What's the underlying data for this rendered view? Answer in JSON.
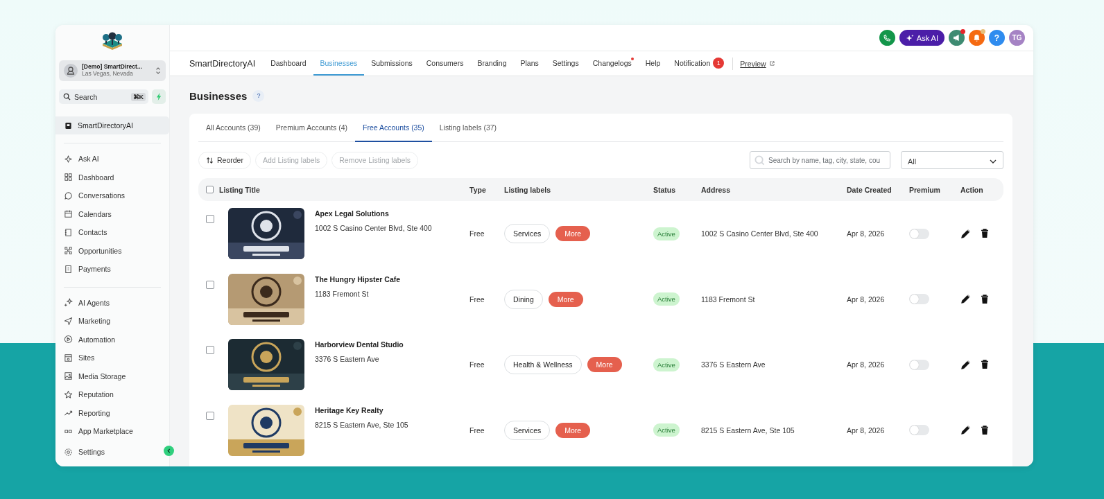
{
  "sidebar": {
    "account": {
      "name": "[Demo] SmartDirect...",
      "location": "Las Vegas, Nevada"
    },
    "search": {
      "placeholder": "Search",
      "shortcut": "⌘K"
    },
    "workspace": {
      "label": "SmartDirectoryAI",
      "selected": true
    },
    "groups": [
      {
        "items": [
          {
            "label": "Ask AI",
            "selected": false
          },
          {
            "label": "Dashboard",
            "selected": false
          },
          {
            "label": "Conversations",
            "selected": false
          },
          {
            "label": "Calendars",
            "selected": false
          },
          {
            "label": "Contacts",
            "selected": false
          },
          {
            "label": "Opportunities",
            "selected": false
          },
          {
            "label": "Payments",
            "selected": false
          }
        ]
      },
      {
        "items": [
          {
            "label": "AI Agents",
            "selected": false
          },
          {
            "label": "Marketing",
            "selected": false
          },
          {
            "label": "Automation",
            "selected": false
          },
          {
            "label": "Sites",
            "selected": false
          },
          {
            "label": "Media Storage",
            "selected": false
          },
          {
            "label": "Reputation",
            "selected": false
          },
          {
            "label": "Reporting",
            "selected": false
          },
          {
            "label": "App Marketplace",
            "selected": false
          }
        ]
      }
    ],
    "settings": "Settings"
  },
  "topbar": {
    "ask_ai": "Ask AI",
    "announcements_dot": true,
    "notifications_dot": true,
    "help": "?",
    "avatar": "TG"
  },
  "nav": {
    "brand": "SmartDirectoryAI",
    "tabs": [
      {
        "label": "Dashboard",
        "selected": false,
        "dot": false
      },
      {
        "label": "Businesses",
        "selected": true,
        "dot": false
      },
      {
        "label": "Submissions",
        "selected": false,
        "dot": false
      },
      {
        "label": "Consumers",
        "selected": false,
        "dot": false
      },
      {
        "label": "Branding",
        "selected": false,
        "dot": false
      },
      {
        "label": "Plans",
        "selected": false,
        "dot": false
      },
      {
        "label": "Settings",
        "selected": false,
        "dot": false
      },
      {
        "label": "Changelogs",
        "selected": false,
        "dot": true
      },
      {
        "label": "Help",
        "selected": false,
        "dot": false
      },
      {
        "label": "Notification",
        "selected": false,
        "dot": false,
        "badge": "1"
      }
    ],
    "preview": "Preview"
  },
  "page": {
    "title": "Businesses",
    "help": "?"
  },
  "tabs": [
    {
      "label": "All Accounts (39)",
      "selected": false
    },
    {
      "label": "Premium Accounts (4)",
      "selected": false
    },
    {
      "label": "Free Accounts (35)",
      "selected": true
    },
    {
      "label": "Listing labels (37)",
      "selected": false
    }
  ],
  "toolbar": {
    "buttons": [
      {
        "label": "Reorder",
        "disabled": false
      },
      {
        "label": "Add Listing labels",
        "disabled": true
      },
      {
        "label": "Remove Listing labels",
        "disabled": true
      }
    ],
    "search": {
      "placeholder": "Search by name, tag, city, state, cou"
    },
    "filter": {
      "value": "All"
    }
  },
  "table": {
    "select_all": false,
    "columns": [
      "Listing Title",
      "Type",
      "Listing labels",
      "Status",
      "Address",
      "Date Created",
      "Premium",
      "Action"
    ],
    "rows": [
      {
        "checked": false,
        "title": "Apex Legal Solutions",
        "subtitle": "1002 S Casino Center Blvd, Ste 400",
        "type": "Free",
        "label": "Services",
        "more": "More",
        "status": "Active",
        "address": "1002 S Casino Center Blvd, Ste 400",
        "date": "Apr 8, 2026",
        "premium": false
      },
      {
        "checked": false,
        "title": "The Hungry Hipster Cafe",
        "subtitle": "1183 Fremont St",
        "type": "Free",
        "label": "Dining",
        "more": "More",
        "status": "Active",
        "address": "1183 Fremont St",
        "date": "Apr 8, 2026",
        "premium": false
      },
      {
        "checked": false,
        "title": "Harborview Dental Studio",
        "subtitle": "3376 S Eastern Ave",
        "type": "Free",
        "label": "Health & Wellness",
        "more": "More",
        "status": "Active",
        "address": "3376 S Eastern Ave",
        "date": "Apr 8, 2026",
        "premium": false
      },
      {
        "checked": false,
        "title": "Heritage Key Realty",
        "subtitle": "8215 S Eastern Ave, Ste 105",
        "type": "Free",
        "label": "Services",
        "more": "More",
        "status": "Active",
        "address": "8215 S Eastern Ave, Ste 105",
        "date": "Apr 8, 2026",
        "premium": false
      }
    ]
  }
}
